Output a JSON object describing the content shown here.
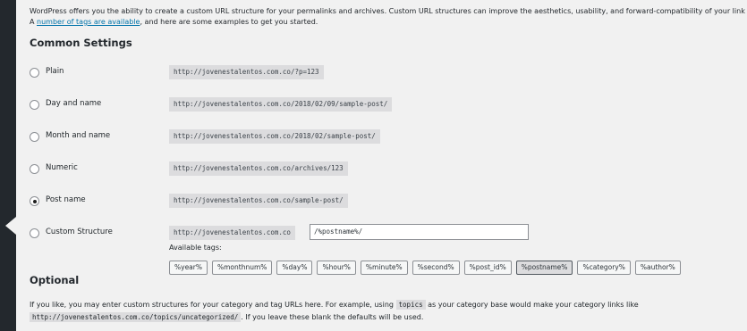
{
  "intro": {
    "line1": "WordPress offers you the ability to create a custom URL structure for your permalinks and archives. Custom URL structures can improve the aesthetics, usability, and forward-compatibility of your link",
    "line2_pre": "A ",
    "line2_link": "number of tags are available",
    "line2_post": ", and here are some examples to get you started."
  },
  "common_settings": {
    "heading": "Common Settings",
    "options": [
      {
        "label": "Plain",
        "example": "http://jovenestalentos.com.co/?p=123",
        "checked": false
      },
      {
        "label": "Day and name",
        "example": "http://jovenestalentos.com.co/2018/02/09/sample-post/",
        "checked": false
      },
      {
        "label": "Month and name",
        "example": "http://jovenestalentos.com.co/2018/02/sample-post/",
        "checked": false
      },
      {
        "label": "Numeric",
        "example": "http://jovenestalentos.com.co/archives/123",
        "checked": false
      },
      {
        "label": "Post name",
        "example": "http://jovenestalentos.com.co/sample-post/",
        "checked": true
      },
      {
        "label": "Custom Structure",
        "example": "http://jovenestalentos.com.co",
        "checked": false
      }
    ],
    "custom_value": "/%postname%/",
    "available_tags_label": "Available tags:",
    "tags": [
      "%year%",
      "%monthnum%",
      "%day%",
      "%hour%",
      "%minute%",
      "%second%",
      "%post_id%",
      "%postname%",
      "%category%",
      "%author%"
    ],
    "active_tag": "%postname%"
  },
  "optional": {
    "heading": "Optional",
    "text_pre": "If you like, you may enter custom structures for your category and tag URLs here. For example, using ",
    "text_code": "topics",
    "text_post": " as your category base would make your category links like",
    "line2_code": "http://jovenestalentos.com.co/topics/uncategorized/",
    "line2_post": ". If you leave these blank the defaults will be used."
  }
}
